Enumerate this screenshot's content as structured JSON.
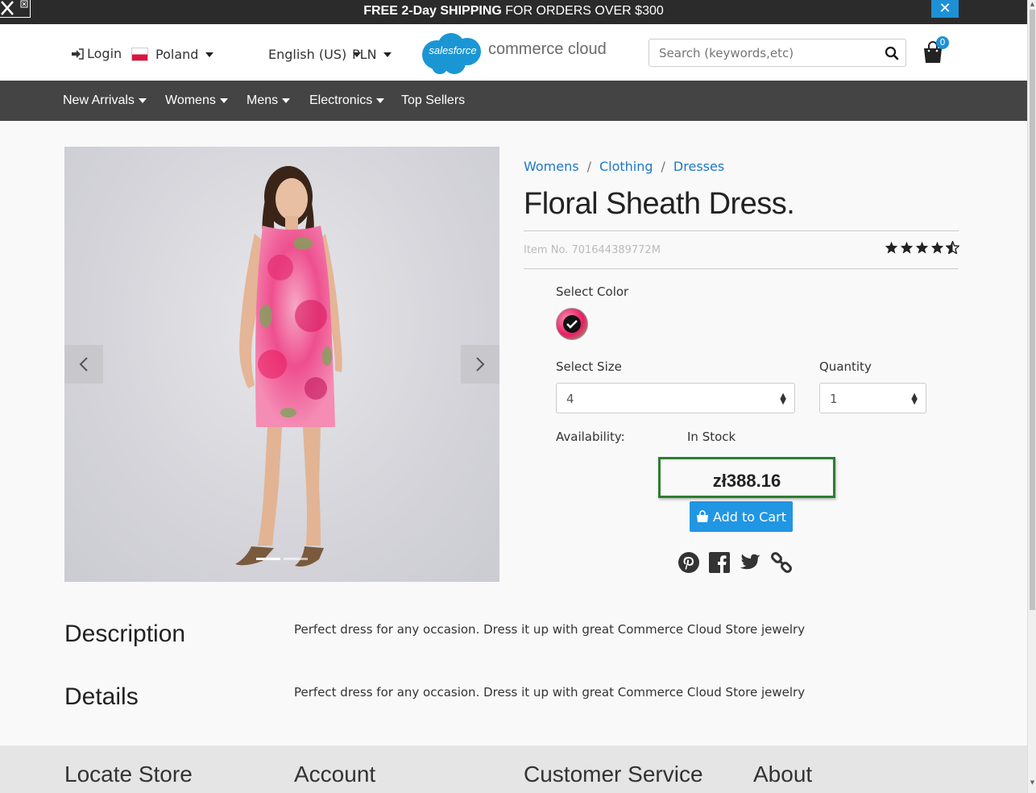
{
  "promo": {
    "bold": "FREE 2-Day SHIPPING",
    "rest": " FOR ORDERS OVER $300",
    "close_label": "✕"
  },
  "header": {
    "login": "Login",
    "country": "Poland",
    "language": "English (US)",
    "currency": "PLN",
    "logo_cloud": "salesforce",
    "logo_text": "commerce cloud",
    "search_placeholder": "Search (keywords,etc)",
    "cart_count": "0"
  },
  "nav": {
    "items": [
      {
        "label": "New Arrivals",
        "dropdown": true
      },
      {
        "label": "Womens",
        "dropdown": true
      },
      {
        "label": "Mens",
        "dropdown": true
      },
      {
        "label": "Electronics",
        "dropdown": true
      },
      {
        "label": "Top Sellers",
        "dropdown": false
      }
    ]
  },
  "breadcrumb": {
    "items": [
      "Womens",
      "Clothing",
      "Dresses"
    ],
    "separator": "/"
  },
  "product": {
    "title": "Floral Sheath Dress.",
    "item_no": "Item No. 701644389772M",
    "rating": 4.5,
    "color_label": "Select Color",
    "size_label": "Select Size",
    "size_value": "4",
    "quantity_label": "Quantity",
    "quantity_value": "1",
    "availability_label": "Availability:",
    "availability_value": "In Stock",
    "price": "zł388.16",
    "add_to_cart": "Add to Cart"
  },
  "description": {
    "title": "Description",
    "text": "Perfect dress for any occasion. Dress it up with great Commerce Cloud Store jewelry"
  },
  "details": {
    "title": "Details",
    "text": "Perfect dress for any occasion. Dress it up with great Commerce Cloud Store jewelry"
  },
  "footer": {
    "columns": [
      "Locate Store",
      "Account",
      "Customer Service",
      "About"
    ]
  },
  "colors": {
    "accent": "#2196e3",
    "nav_bg": "#444444",
    "promo_bg": "#2b2b2b",
    "price_border": "#2e7d32",
    "link": "#1e78c8"
  }
}
